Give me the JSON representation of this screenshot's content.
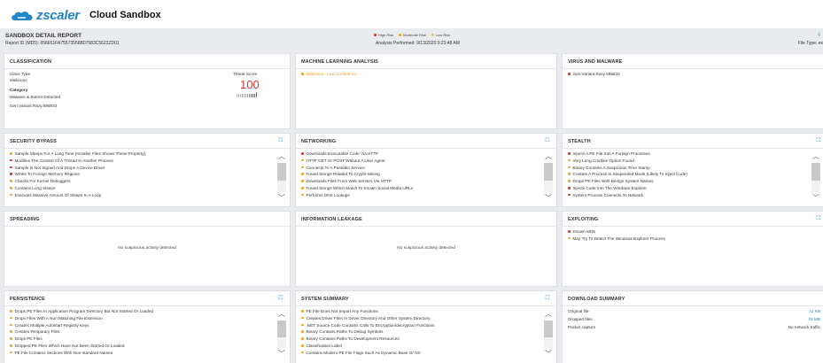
{
  "app": {
    "brand": "zscaler",
    "product": "Cloud Sandbox",
    "brand_color": "#1f86c9"
  },
  "report": {
    "title": "SANDBOX DETAIL REPORT",
    "id_label": "Report ID (MD5): 656651FA75573558B07583C5623ZD01",
    "analysis": "Analysis Performed: 9/13/2020 9:23:48 AM",
    "file_type": "File Type: ex",
    "legend": [
      {
        "label": "High Risk",
        "color": "#d9352b"
      },
      {
        "label": "Moderate Risk",
        "color": "#f0a021"
      },
      {
        "label": "Low Risk",
        "color": "#e6c84a"
      }
    ]
  },
  "classification": {
    "title": "CLASSIFICATION",
    "class_type_label": "Class Type",
    "class_type_value": "Malicious",
    "category_label": "Category",
    "category_value": "Malware & Botnet Detected",
    "threat_name": "Gen:Variant.Razy.595833",
    "threat_score_label": "Threat Score",
    "threat_score": "100"
  },
  "ml": {
    "title": "MACHINE LEARNING ANALYSIS",
    "result": "Malicious - Low Confidence"
  },
  "virus": {
    "title": "VIRUS AND MALWARE",
    "items": [
      {
        "text": "Gen:Variant.Razy.595833",
        "risk": "red"
      }
    ]
  },
  "security_bypass": {
    "title": "SECURITY BYPASS",
    "items": [
      {
        "text": "Sample Sleeps For A Long Time (Installer Files Shows These Property).",
        "risk": "orange"
      },
      {
        "text": "Modifies The Context Of A Thread In Another Process",
        "risk": "red"
      },
      {
        "text": "Sample Is Not Signed And Drops A Device Driver",
        "risk": "red"
      },
      {
        "text": "Writes To Foreign Memory Regions",
        "risk": "red"
      },
      {
        "text": "Checks For Kernel Debuggers",
        "risk": "orange"
      },
      {
        "text": "Contains Long Sleeps",
        "risk": "orange"
      },
      {
        "text": "Executes Massive Amount Of Sleeps In A Loop",
        "risk": "orange"
      }
    ]
  },
  "networking": {
    "title": "NETWORKING",
    "items": [
      {
        "text": "Downloads Executable Code Via HTTP",
        "risk": "red"
      },
      {
        "text": "HTTP GET Or POST Without A User Agent",
        "risk": "orange"
      },
      {
        "text": "Connects To A Pastebin Service",
        "risk": "orange"
      },
      {
        "text": "Found Strings Related To Crypto-Mining",
        "risk": "orange"
      },
      {
        "text": "Downloads Files From Web Servers Via HTTP",
        "risk": "orange"
      },
      {
        "text": "Found Strings Which Match To Known Social Media URLs",
        "risk": "orange"
      },
      {
        "text": "Performs DNS Lookups",
        "risk": "orange"
      }
    ]
  },
  "stealth": {
    "title": "STEALTH",
    "items": [
      {
        "text": "Injects A PE File Into A Foreign Processes",
        "risk": "red"
      },
      {
        "text": "Very Long Cmdline Option Found",
        "risk": "orange"
      },
      {
        "text": "Binary Contains A Suspicious Time Stamp",
        "risk": "orange"
      },
      {
        "text": "Creates A Process In Suspended Mode (Likely To Inject Code)",
        "risk": "orange"
      },
      {
        "text": "Drops PE Files With Benign System Names",
        "risk": "orange"
      },
      {
        "text": "Injects Code Into The Windows Explorer",
        "risk": "red"
      },
      {
        "text": "System Process Connects To Network",
        "risk": "red"
      }
    ]
  },
  "spreading": {
    "title": "SPREADING",
    "empty": "No suspicious activity detected"
  },
  "info_leakage": {
    "title": "INFORMATION LEAKAGE",
    "empty": "No suspicious activity detected"
  },
  "exploiting": {
    "title": "EXPLOITING",
    "items": [
      {
        "text": "Known MD5",
        "risk": "red"
      },
      {
        "text": "May Try To Detect The Windows Explorer Process",
        "risk": "orange"
      }
    ]
  },
  "persistence": {
    "title": "PERSISTENCE",
    "items": [
      {
        "text": "Drops PE Files In Application Program Directory But Not Started Or Loaded",
        "risk": "orange"
      },
      {
        "text": "Drops Files With A Non Matching File Extension",
        "risk": "orange"
      },
      {
        "text": "Creates Multiple Autostart Registry Keys",
        "risk": "orange"
      },
      {
        "text": "Creates Temporary Files",
        "risk": "orange"
      },
      {
        "text": "Drops PE Files",
        "risk": "orange"
      },
      {
        "text": "Dropped PE Files Which Have Not Been Started Or Loaded",
        "risk": "orange"
      },
      {
        "text": "PE File Contains Sections With Non-standard Names",
        "risk": "orange"
      }
    ]
  },
  "system_summary": {
    "title": "SYSTEM SUMMARY",
    "items": [
      {
        "text": "PE File Does Not Import Any Functions",
        "risk": "orange"
      },
      {
        "text": "Creates Driver Files In Driver Directory And Other System Directory.",
        "risk": "orange"
      },
      {
        "text": ".NET Source Code Contains Calls To Encryption/decryption Functions",
        "risk": "orange"
      },
      {
        "text": "Binary Contains Paths To Debug Symbols",
        "risk": "orange"
      },
      {
        "text": "Binary Contains Paths To Development Resources",
        "risk": "orange"
      },
      {
        "text": "Classification Label",
        "risk": "orange"
      },
      {
        "text": "Contains Modern PE File Flags Such As Dynamic Base Or NX",
        "risk": "orange"
      }
    ]
  },
  "download": {
    "title": "DOWNLOAD SUMMARY",
    "rows": [
      {
        "label": "Original file",
        "value": "41 KB"
      },
      {
        "label": "Dropped files",
        "value": "32 MB"
      },
      {
        "label": "Packet capture",
        "value": "No network traffic"
      }
    ]
  }
}
